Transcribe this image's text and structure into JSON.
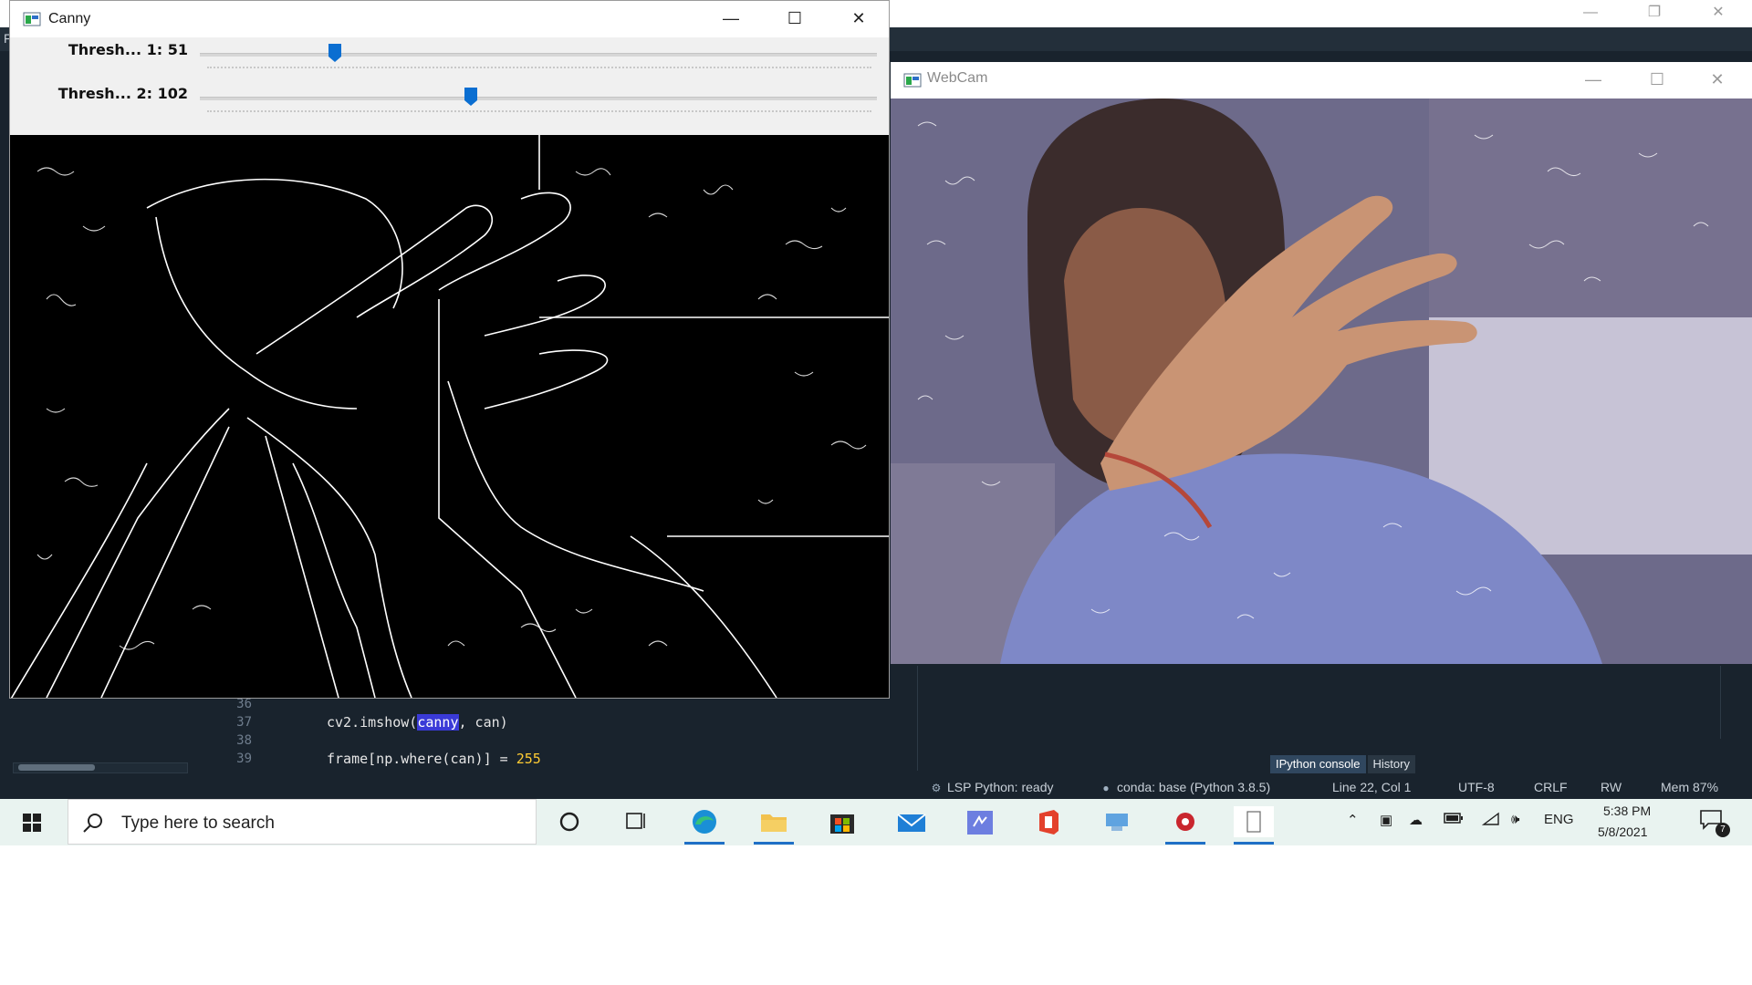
{
  "background_app": {
    "menu_letter": "F",
    "code_lines": [
      {
        "num": "36",
        "pre": "",
        "hl": "",
        "mid": "",
        "num_val": ""
      },
      {
        "num": "37",
        "pre": "cv2.imshow(",
        "hl": "canny",
        "mid": ", can)",
        "num_val": ""
      },
      {
        "num": "38",
        "pre": "",
        "hl": "",
        "mid": "",
        "num_val": ""
      },
      {
        "num": "39",
        "pre": "frame[np.where(can)] = ",
        "hl": "",
        "mid": "",
        "num_val": "255"
      }
    ],
    "console_tabs": [
      "IPython console",
      "History"
    ],
    "status": {
      "lsp": "LSP Python: ready",
      "conda": "conda: base (Python 3.8.5)",
      "position": "Line 22, Col 1",
      "encoding": "UTF-8",
      "eol": "CRLF",
      "permissions": "RW",
      "memory": "Mem 87%"
    }
  },
  "canny_window": {
    "title": "Canny",
    "trackbars": [
      {
        "label": "Thresh... 1: 51",
        "value": 51,
        "max": 255
      },
      {
        "label": "Thresh... 2: 102",
        "value": 102,
        "max": 255
      }
    ]
  },
  "webcam_window": {
    "title": "WebCam"
  },
  "taskbar": {
    "search_placeholder": "Type here to search",
    "apps": [
      "cortana-icon",
      "task-view-icon",
      "edge-icon",
      "file-explorer-icon",
      "store-icon",
      "mail-icon",
      "visual-studio-icon",
      "office-icon",
      "network-app-icon",
      "recorder-icon",
      "notepad-icon"
    ],
    "language": "ENG",
    "time": "5:38 PM",
    "date": "5/8/2021",
    "notification_count": "7"
  },
  "colors": {
    "spyder_bg": "#19232d",
    "taskbar_bg": "#e9f3f0",
    "accent": "#1f6fc6",
    "trackbar_thumb": "#0a6ed1"
  }
}
